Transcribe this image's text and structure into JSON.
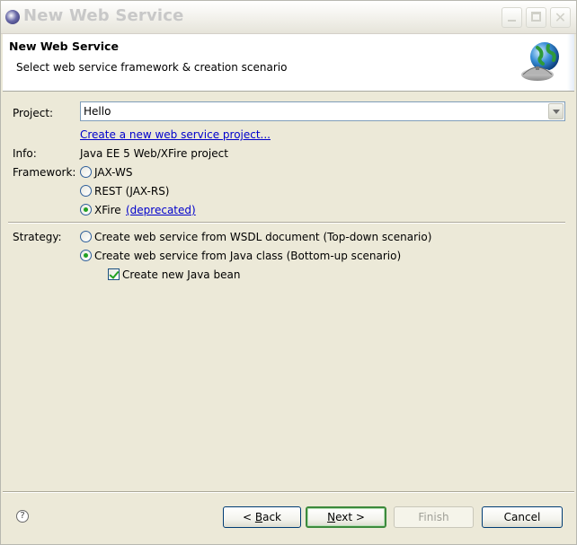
{
  "window": {
    "title": "New Web Service"
  },
  "header": {
    "title": "New Web Service",
    "description": "Select web service framework & creation scenario"
  },
  "project": {
    "label": "Project:",
    "value": "Hello",
    "create_link": "Create a new web service project..."
  },
  "info": {
    "label": "Info:",
    "value": "Java EE 5 Web/XFire project"
  },
  "framework": {
    "label": "Framework:",
    "options": [
      {
        "label": "JAX-WS",
        "selected": false
      },
      {
        "label": "REST (JAX-RS)",
        "selected": false
      },
      {
        "label": "XFire",
        "selected": true
      }
    ],
    "deprecated_link": "(deprecated)"
  },
  "strategy": {
    "label": "Strategy:",
    "options": [
      {
        "label": "Create web service from WSDL document (Top-down scenario)",
        "selected": false
      },
      {
        "label": "Create web service from Java class (Bottom-up scenario)",
        "selected": true
      }
    ],
    "java_bean": {
      "label": "Create new Java bean",
      "checked": true
    }
  },
  "buttons": {
    "back_prefix": "< ",
    "back_mnemonic": "B",
    "back_rest": "ack",
    "next_mnemonic": "N",
    "next_rest": "ext >",
    "finish": "Finish",
    "cancel": "Cancel"
  },
  "help": {
    "symbol": "?"
  },
  "colors": {
    "dialog_bg": "#ece9d8",
    "link": "#0000cc",
    "radio_dot": "#21a121",
    "default_button_border": "#3c8a3c"
  }
}
